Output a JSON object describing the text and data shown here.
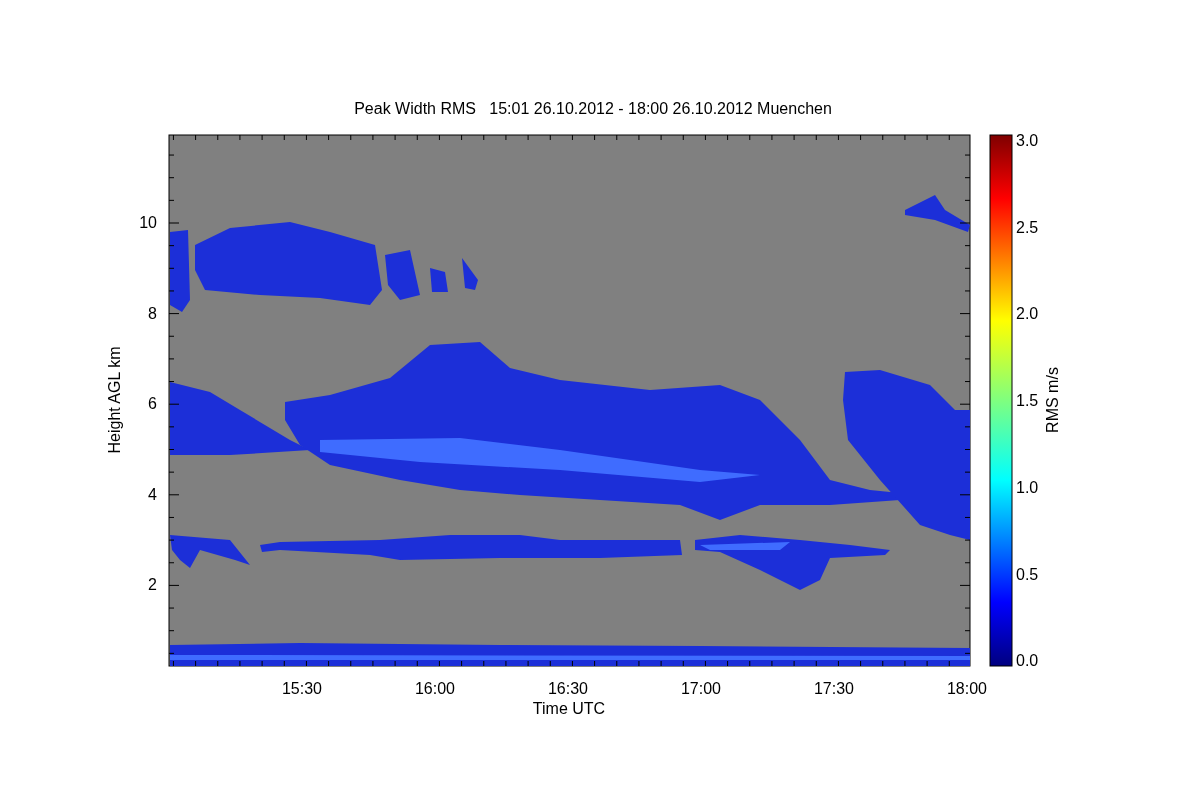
{
  "title": "Peak Width RMS   15:01 26.10.2012 - 18:00 26.10.2012 Muenchen",
  "x_axis": {
    "label": "Time UTC",
    "ticks": [
      "15:30",
      "16:00",
      "16:30",
      "17:00",
      "17:30",
      "18:00"
    ]
  },
  "y_axis": {
    "label": "Height AGL km",
    "ticks": [
      "10",
      "8",
      "6",
      "4",
      "2"
    ]
  },
  "colorbar": {
    "label": "RMS m/s",
    "ticks": [
      "3.0",
      "2.5",
      "2.0",
      "1.5",
      "1.0",
      "0.5",
      "0.0"
    ]
  }
}
